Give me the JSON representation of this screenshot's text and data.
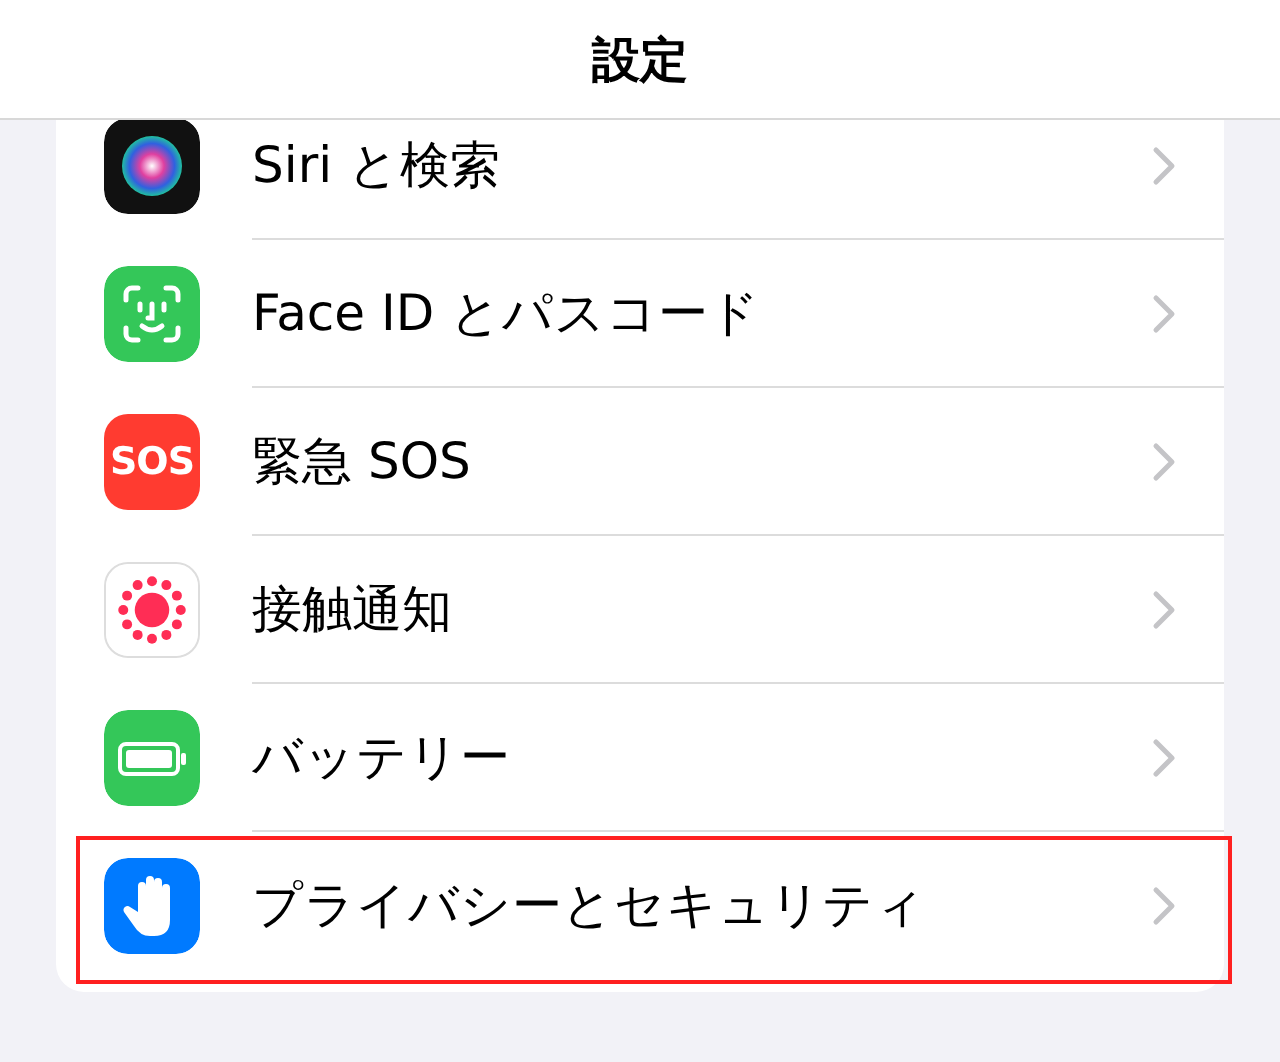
{
  "header": {
    "title": "設定"
  },
  "rows": [
    {
      "kind": "siri",
      "label": "Siri と検索",
      "highlighted": false
    },
    {
      "kind": "faceid",
      "label": "Face ID とパスコード",
      "highlighted": false
    },
    {
      "kind": "sos",
      "icon_text": "SOS",
      "label": "緊急 SOS",
      "highlighted": false
    },
    {
      "kind": "exposure",
      "label": "接触通知",
      "highlighted": false
    },
    {
      "kind": "battery",
      "label": "バッテリー",
      "highlighted": false
    },
    {
      "kind": "privacy",
      "label": "プライバシーとセキュリティ",
      "highlighted": true
    }
  ]
}
